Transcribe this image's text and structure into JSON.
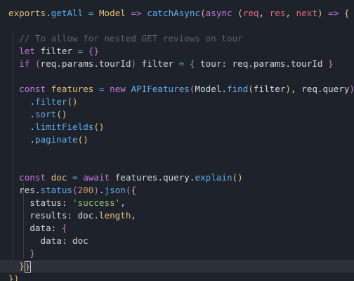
{
  "code": {
    "lines": [
      [
        [
          "v",
          "exports"
        ],
        [
          "t",
          "."
        ],
        [
          "f",
          "getAll"
        ],
        [
          "t",
          " "
        ],
        [
          "o",
          "="
        ],
        [
          "t",
          " "
        ],
        [
          "v",
          "Model"
        ],
        [
          "t",
          " "
        ],
        [
          "k",
          "=>"
        ],
        [
          "t",
          " "
        ],
        [
          "f",
          "catchAsync"
        ],
        [
          "b",
          "("
        ],
        [
          "k",
          "async"
        ],
        [
          "t",
          " "
        ],
        [
          "b",
          "("
        ],
        [
          "p",
          "req"
        ],
        [
          "t",
          ", "
        ],
        [
          "p",
          "res"
        ],
        [
          "t",
          ", "
        ],
        [
          "p",
          "next"
        ],
        [
          "b",
          ")"
        ],
        [
          "t",
          " "
        ],
        [
          "k",
          "=>"
        ],
        [
          "t",
          " "
        ],
        [
          "b",
          "{"
        ]
      ],
      [],
      [
        [
          "t",
          "  "
        ],
        [
          "c",
          "// To allow for nested GET reviews on tour"
        ]
      ],
      [
        [
          "t",
          "  "
        ],
        [
          "k",
          "let"
        ],
        [
          "t",
          " filter "
        ],
        [
          "o",
          "="
        ],
        [
          "t",
          " "
        ],
        [
          "k",
          "{}"
        ]
      ],
      [
        [
          "t",
          "  "
        ],
        [
          "k",
          "if"
        ],
        [
          "t",
          " "
        ],
        [
          "k",
          "("
        ],
        [
          "t",
          "req.params.tourId"
        ],
        [
          "k",
          ")"
        ],
        [
          "t",
          " filter "
        ],
        [
          "o",
          "="
        ],
        [
          "t",
          " "
        ],
        [
          "k",
          "{"
        ],
        [
          "t",
          " tour: req.params.tourId "
        ],
        [
          "k",
          "}"
        ]
      ],
      [],
      [
        [
          "t",
          "  "
        ],
        [
          "k",
          "const"
        ],
        [
          "t",
          " "
        ],
        [
          "v",
          "features"
        ],
        [
          "t",
          " "
        ],
        [
          "o",
          "="
        ],
        [
          "t",
          " "
        ],
        [
          "k",
          "new"
        ],
        [
          "t",
          " "
        ],
        [
          "f",
          "APIFeatures"
        ],
        [
          "k",
          "("
        ],
        [
          "t",
          "Model."
        ],
        [
          "f",
          "find"
        ],
        [
          "b",
          "("
        ],
        [
          "t",
          "filter"
        ],
        [
          "b",
          ")"
        ],
        [
          "t",
          ", req.query"
        ],
        [
          "k",
          ")"
        ]
      ],
      [
        [
          "t",
          "    "
        ],
        [
          "t",
          "."
        ],
        [
          "f",
          "filter"
        ],
        [
          "b",
          "()"
        ]
      ],
      [
        [
          "t",
          "    "
        ],
        [
          "t",
          "."
        ],
        [
          "f",
          "sort"
        ],
        [
          "b",
          "()"
        ]
      ],
      [
        [
          "t",
          "    "
        ],
        [
          "t",
          "."
        ],
        [
          "f",
          "limitFields"
        ],
        [
          "b",
          "()"
        ]
      ],
      [
        [
          "t",
          "    "
        ],
        [
          "t",
          "."
        ],
        [
          "f",
          "paginate"
        ],
        [
          "b",
          "()"
        ]
      ],
      [],
      [],
      [
        [
          "t",
          "  "
        ],
        [
          "k",
          "const"
        ],
        [
          "t",
          " "
        ],
        [
          "v",
          "doc"
        ],
        [
          "t",
          " "
        ],
        [
          "o",
          "="
        ],
        [
          "t",
          " "
        ],
        [
          "k",
          "await"
        ],
        [
          "t",
          " features.query."
        ],
        [
          "f",
          "explain"
        ],
        [
          "b",
          "()"
        ]
      ],
      [
        [
          "t",
          "  res."
        ],
        [
          "f",
          "status"
        ],
        [
          "k",
          "("
        ],
        [
          "n",
          "200"
        ],
        [
          "k",
          ")"
        ],
        [
          "t",
          "."
        ],
        [
          "f",
          "json"
        ],
        [
          "k",
          "("
        ],
        [
          "b",
          "{"
        ]
      ],
      [
        [
          "t",
          "    status: "
        ],
        [
          "s",
          "'success'"
        ],
        [
          "t",
          ","
        ]
      ],
      [
        [
          "t",
          "    results: doc."
        ],
        [
          "v",
          "length"
        ],
        [
          "t",
          ","
        ]
      ],
      [
        [
          "t",
          "    data: "
        ],
        [
          "k",
          "{"
        ]
      ],
      [
        [
          "t",
          "      data: doc"
        ]
      ],
      [
        [
          "t",
          "    "
        ],
        [
          "k",
          "}"
        ]
      ],
      [
        [
          "t",
          "  "
        ],
        [
          "b",
          "}"
        ],
        [
          "cursor",
          ")"
        ]
      ],
      [
        [
          "b",
          "})"
        ]
      ]
    ]
  }
}
